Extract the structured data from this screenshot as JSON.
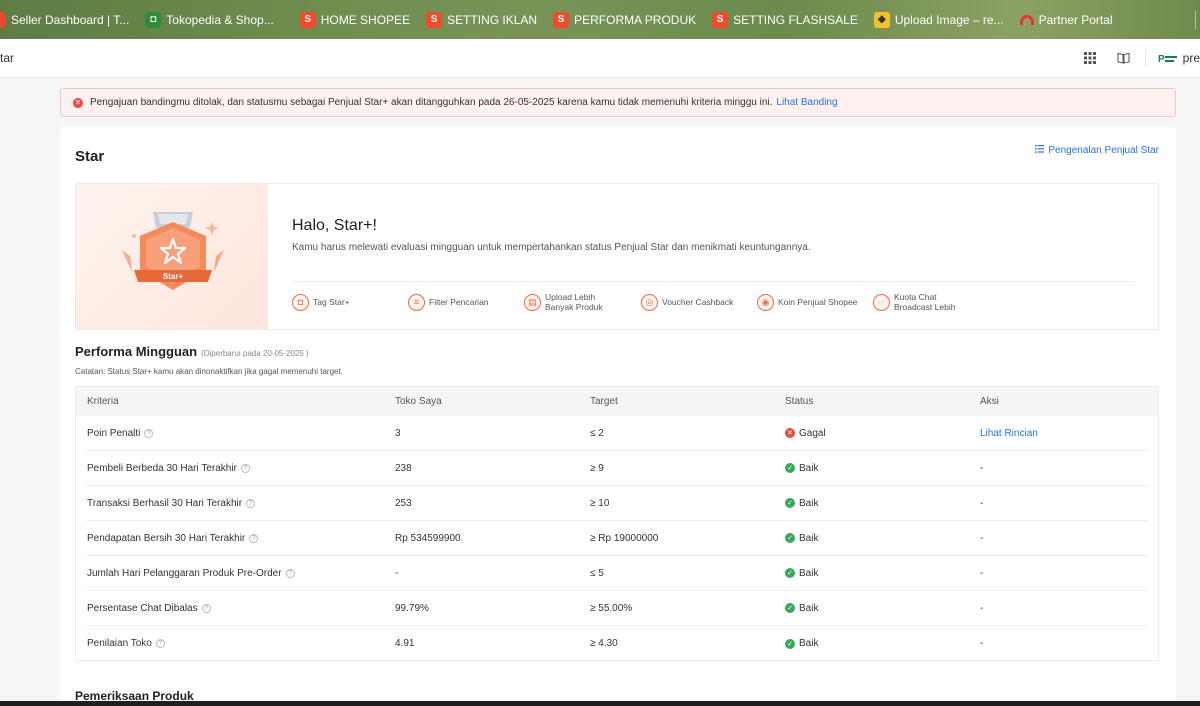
{
  "bookmarks": [
    {
      "label": "Seller Dashboard | T...",
      "icon": "red"
    },
    {
      "label": "Tokopedia & Shop...",
      "icon": "green"
    },
    {
      "label": "HOME SHOPEE",
      "icon": "shopee"
    },
    {
      "label": "SETTING IKLAN",
      "icon": "shopee"
    },
    {
      "label": "PERFORMA PRODUK",
      "icon": "shopee"
    },
    {
      "label": "SETTING FLASHSALE",
      "icon": "shopee"
    },
    {
      "label": "Upload Image – re...",
      "icon": "yellow"
    },
    {
      "label": "Partner Portal",
      "icon": "arch"
    }
  ],
  "topbar": {
    "breadcrumb": "tar",
    "shop_name": "pre"
  },
  "alert": {
    "message": "Pengajuan bandingmu ditolak, dan statusmu sebagai Penjual Star+ akan ditangguhkan pada 26-05-2025 karena kamu tidak memenuhi kriteria minggu ini.",
    "link": "Lihat Banding"
  },
  "page": {
    "title": "Star",
    "intro_link": "Pengenalan Penjual Star"
  },
  "banner": {
    "badge_label": "Star+",
    "greeting": "Halo, Star+!",
    "description": "Kamu harus melewati evaluasi mingguan untuk mempertahankan status Penjual Star dan menikmati keuntungannya.",
    "benefits": [
      {
        "label": "Tag Star+",
        "icon": "tag-icon"
      },
      {
        "label": "Filter Pencarian",
        "icon": "filter-icon"
      },
      {
        "label": "Upload Lebih Banyak Produk",
        "icon": "upload-icon"
      },
      {
        "label": "Voucher Cashback",
        "icon": "voucher-icon"
      },
      {
        "label": "Koin Penjual Shopee",
        "icon": "coin-icon"
      },
      {
        "label": "Kuota Chat Broadcast Lebih",
        "icon": "chat-icon"
      }
    ]
  },
  "performance": {
    "title": "Performa Mingguan",
    "updated": "(Diperbarui pada 20-05-2025 )",
    "note": "Catatan: Status Star+ kamu akan dinonaktifkan jika gagal memenuhi target.",
    "headers": [
      "Kriteria",
      "Toko Saya",
      "Target",
      "Status",
      "Aksi"
    ],
    "rows": [
      {
        "criteria": "Poin Penalti",
        "mine": "3",
        "target": "≤ 2",
        "status": "Gagal",
        "ok": false,
        "action": "Lihat Rincian"
      },
      {
        "criteria": "Pembeli Berbeda 30 Hari Terakhir",
        "mine": "238",
        "target": "≥ 9",
        "status": "Baik",
        "ok": true,
        "action": "-"
      },
      {
        "criteria": "Transaksi Berhasil 30 Hari Terakhir",
        "mine": "253",
        "target": "≥ 10",
        "status": "Baik",
        "ok": true,
        "action": "-"
      },
      {
        "criteria": "Pendapatan Bersih 30 Hari Terakhir",
        "mine": "Rp 534599900",
        "target": "≥ Rp 19000000",
        "status": "Baik",
        "ok": true,
        "action": "-"
      },
      {
        "criteria": "Jumlah Hari Pelanggaran Produk Pre-Order",
        "mine": "-",
        "target": "≤ 5",
        "status": "Baik",
        "ok": true,
        "action": "-"
      },
      {
        "criteria": "Persentase Chat Dibalas",
        "mine": "99.79%",
        "target": "≥ 55.00%",
        "status": "Baik",
        "ok": true,
        "action": "-"
      },
      {
        "criteria": "Penilaian Toko",
        "mine": "4.91",
        "target": "≥ 4.30",
        "status": "Baik",
        "ok": true,
        "action": "-"
      }
    ]
  },
  "section2": {
    "title": "Pemeriksaan Produk"
  },
  "colors": {
    "accent_link": "#2673dd",
    "ok": "#3aa85b",
    "fail": "#e84a3c",
    "brand_orange": "#ee6a43"
  }
}
